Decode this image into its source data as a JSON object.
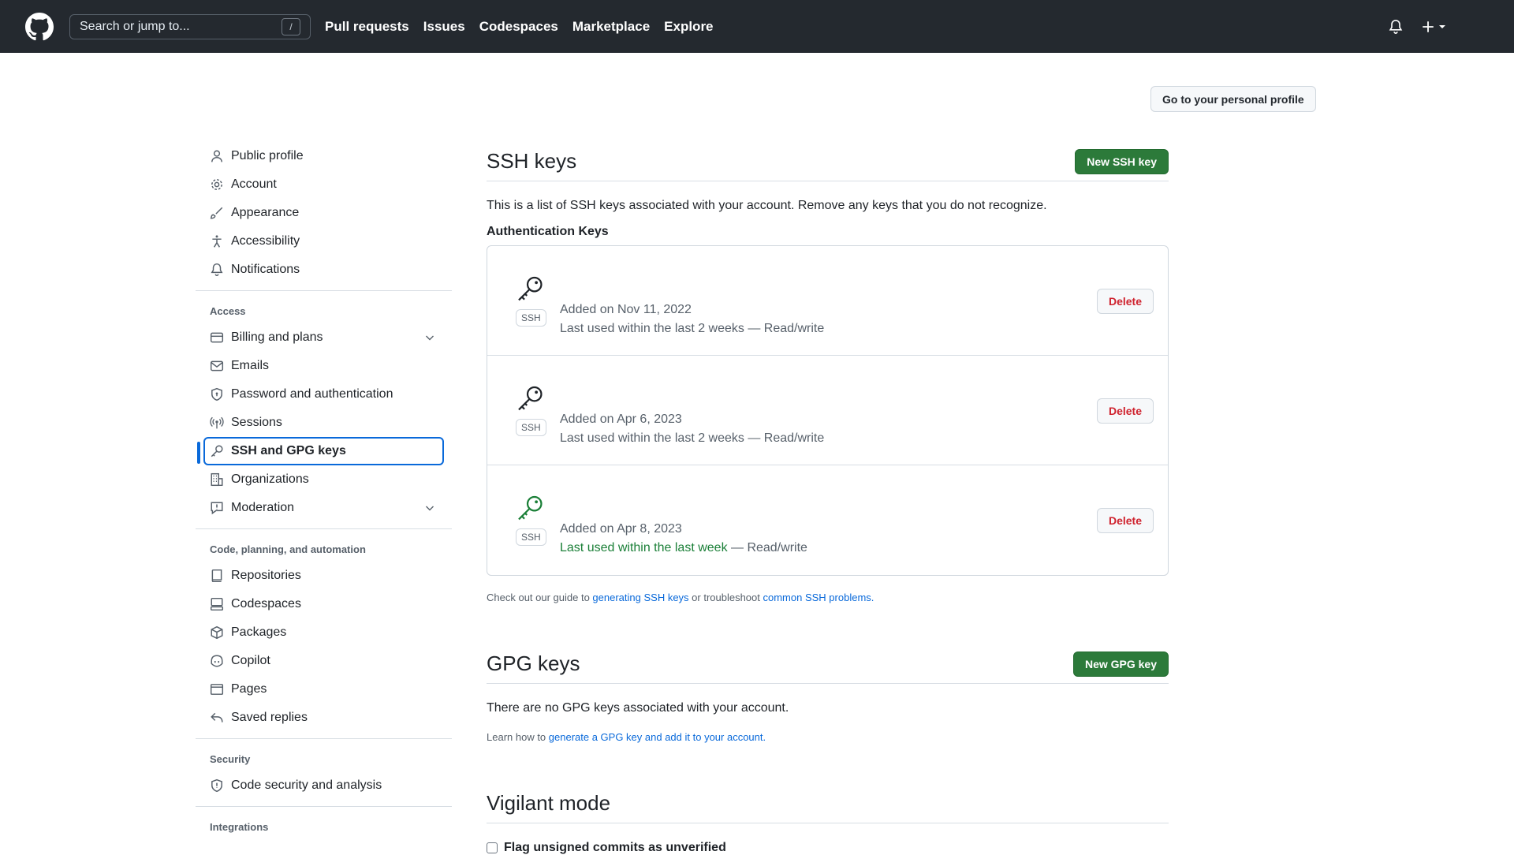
{
  "header": {
    "search_placeholder": "Search or jump to...",
    "search_shortcut": "/",
    "nav": [
      "Pull requests",
      "Issues",
      "Codespaces",
      "Marketplace",
      "Explore"
    ]
  },
  "profile_button": "Go to your personal profile",
  "sidebar": {
    "group1": [
      "Public profile",
      "Account",
      "Appearance",
      "Accessibility",
      "Notifications"
    ],
    "access_label": "Access",
    "access": [
      "Billing and plans",
      "Emails",
      "Password and authentication",
      "Sessions",
      "SSH and GPG keys",
      "Organizations",
      "Moderation"
    ],
    "code_label": "Code, planning, and automation",
    "code": [
      "Repositories",
      "Codespaces",
      "Packages",
      "Copilot",
      "Pages",
      "Saved replies"
    ],
    "security_label": "Security",
    "security": [
      "Code security and analysis"
    ],
    "integrations_label": "Integrations"
  },
  "ssh": {
    "title": "SSH keys",
    "new_button": "New SSH key",
    "description": "This is a list of SSH keys associated with your account. Remove any keys that you do not recognize.",
    "auth_title": "Authentication Keys",
    "tag": "SSH",
    "delete_label": "Delete",
    "keys": [
      {
        "added": "Added on Nov 11, 2022",
        "used": "Last used within the last 2 weeks",
        "access": " — Read/write"
      },
      {
        "added": "Added on Apr 6, 2023",
        "used": "Last used within the last 2 weeks",
        "access": " — Read/write"
      },
      {
        "added": "Added on Apr 8, 2023",
        "used": "Last used within the last week",
        "access": " — Read/write"
      }
    ],
    "note_prefix": "Check out our guide to ",
    "note_link1": "generating SSH keys",
    "note_mid": " or troubleshoot ",
    "note_link2": "common SSH problems."
  },
  "gpg": {
    "title": "GPG keys",
    "new_button": "New GPG key",
    "empty": "There are no GPG keys associated with your account.",
    "learn_prefix": "Learn how to ",
    "learn_link": "generate a GPG key and add it to your account."
  },
  "vigilant": {
    "title": "Vigilant mode",
    "checkbox_label": "Flag unsigned commits as unverified"
  },
  "colors": {
    "header_bg": "#24292f",
    "accent": "#0969da",
    "green_button": "#2c7a3a",
    "danger": "#cf222e",
    "recent_green": "#1a7f37"
  }
}
